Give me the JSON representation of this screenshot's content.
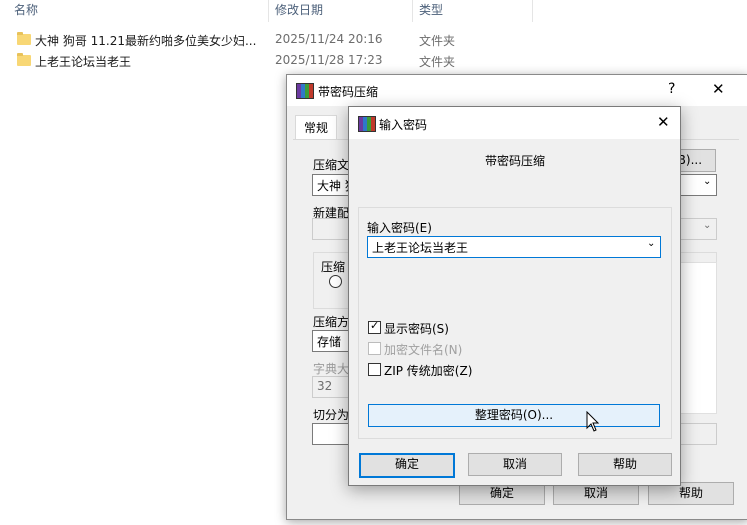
{
  "explorer": {
    "columns": {
      "name": "名称",
      "modified": "修改日期",
      "type": "类型"
    },
    "files": [
      {
        "name": "大神 狗哥 11.21最新约啪多位美女少妇...",
        "modified": "2025/11/24 20:16",
        "type": "文件夹"
      },
      {
        "name": "上老王论坛当老王",
        "modified": "2025/11/28 17:23",
        "type": "文件夹"
      }
    ]
  },
  "back_dialog": {
    "title": "带密码压缩",
    "help_glyph": "?",
    "close_glyph": "✕",
    "tab_general": "常规",
    "browse_button_partial": "(B)...",
    "label_archive_name_partial": "压缩文",
    "archive_name_value_partial": "大神 狗",
    "label_new_config_partial": "新建配",
    "label_compress_partial": "压缩",
    "label_compress_method_partial": "压缩方",
    "compress_method_value": "存储",
    "label_dict_size_partial": "字典大",
    "dict_size_value": "32",
    "label_split_partial": "切分为",
    "ok_button": "确定",
    "cancel_button": "取消",
    "help_button": "帮助"
  },
  "password_dialog": {
    "title": "输入密码",
    "close_glyph": "✕",
    "subtitle": "带密码压缩",
    "password_label": "输入密码(E)",
    "password_value": "上老王论坛当老王",
    "show_password": {
      "label": "显示密码(S)",
      "checked": true
    },
    "encrypt_filenames": {
      "label": "加密文件名(N)",
      "checked": false,
      "enabled": false
    },
    "zip_legacy": {
      "label": "ZIP 传统加密(Z)",
      "checked": false
    },
    "organize_button": "整理密码(O)...",
    "ok_button": "确定",
    "cancel_button": "取消",
    "help_button": "帮助"
  }
}
